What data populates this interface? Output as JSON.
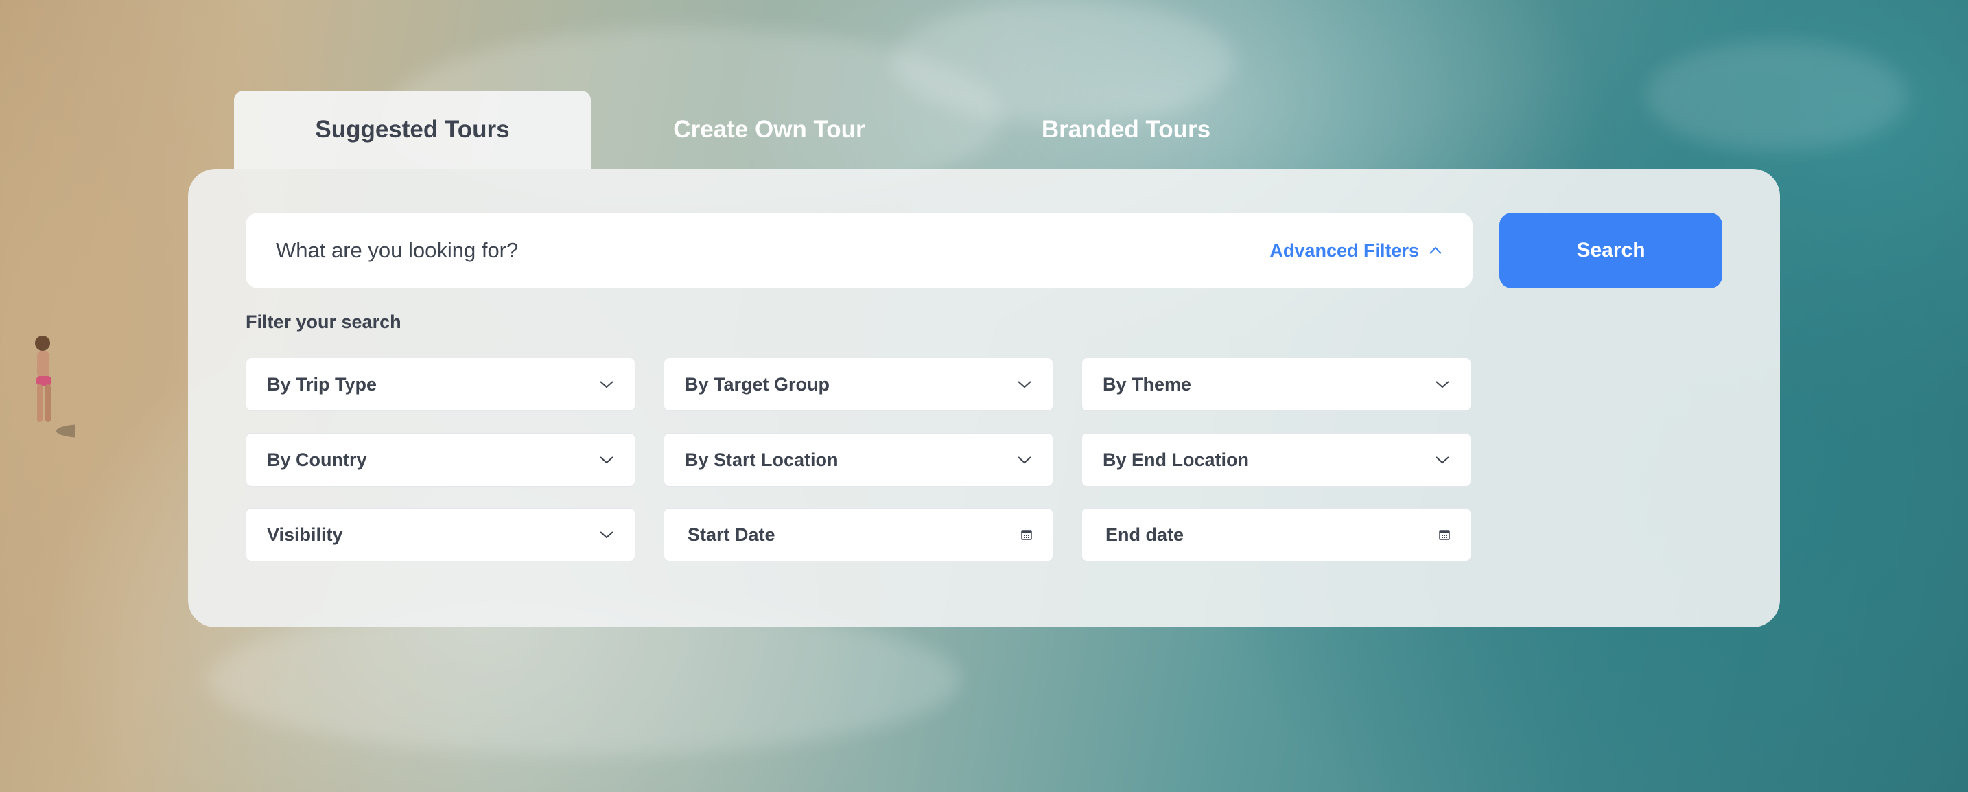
{
  "tabs": [
    {
      "label": "Suggested Tours",
      "active": true
    },
    {
      "label": "Create Own Tour",
      "active": false
    },
    {
      "label": "Branded Tours",
      "active": false
    }
  ],
  "search": {
    "placeholder": "What are you looking for?",
    "advanced_filters_label": "Advanced Filters",
    "advanced_filters_icon": "chevron-up-icon",
    "button_label": "Search"
  },
  "filters": {
    "heading": "Filter your search",
    "dropdowns": {
      "trip_type": "By Trip Type",
      "target_group": "By Target Group",
      "theme": "By Theme",
      "country": "By Country",
      "start_location": "By Start Location",
      "end_location": "By End Location",
      "visibility": "Visibility"
    },
    "dates": {
      "start": "Start Date",
      "end": "End date"
    },
    "dropdown_icon": "chevron-down-icon",
    "date_icon": "calendar-icon"
  },
  "colors": {
    "accent": "#3b82f6",
    "text": "#3d4450",
    "panel": "#f0f2f2"
  }
}
